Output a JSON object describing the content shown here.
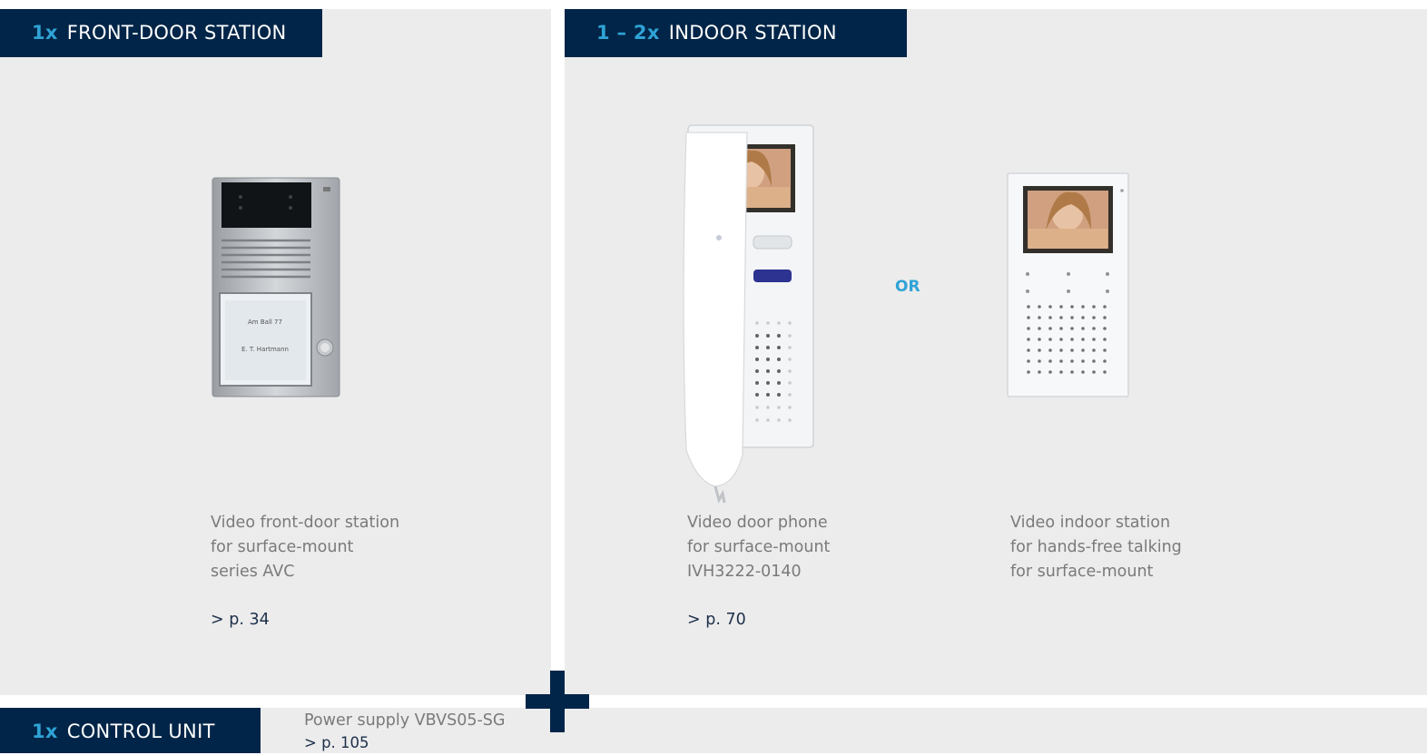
{
  "front_door": {
    "qty": "1x",
    "title": "FRONT-DOOR STATION",
    "description": [
      "Video front-door station",
      "for surface-mount",
      "series AVC"
    ],
    "page_ref": "> p. 34",
    "nameplate_lines": [
      "Am Ball 77",
      "E. T. Hartmann"
    ]
  },
  "indoor": {
    "qty": "1 – 2x",
    "title": "INDOOR STATION",
    "or_label": "OR",
    "phone": {
      "description": [
        "Video door phone",
        "for surface-mount",
        "IVH3222-0140"
      ],
      "page_ref": "> p. 70"
    },
    "handsfree": {
      "description": [
        "Video indoor station",
        "for hands-free talking",
        "for surface-mount"
      ]
    }
  },
  "control_unit": {
    "qty": "1x",
    "title": "CONTROL UNIT",
    "description": "Power supply VBVS05-SG",
    "page_ref": "> p. 105"
  },
  "colors": {
    "header_bg": "#002548",
    "accent": "#2fa3d6",
    "panel_bg": "#ececec"
  }
}
